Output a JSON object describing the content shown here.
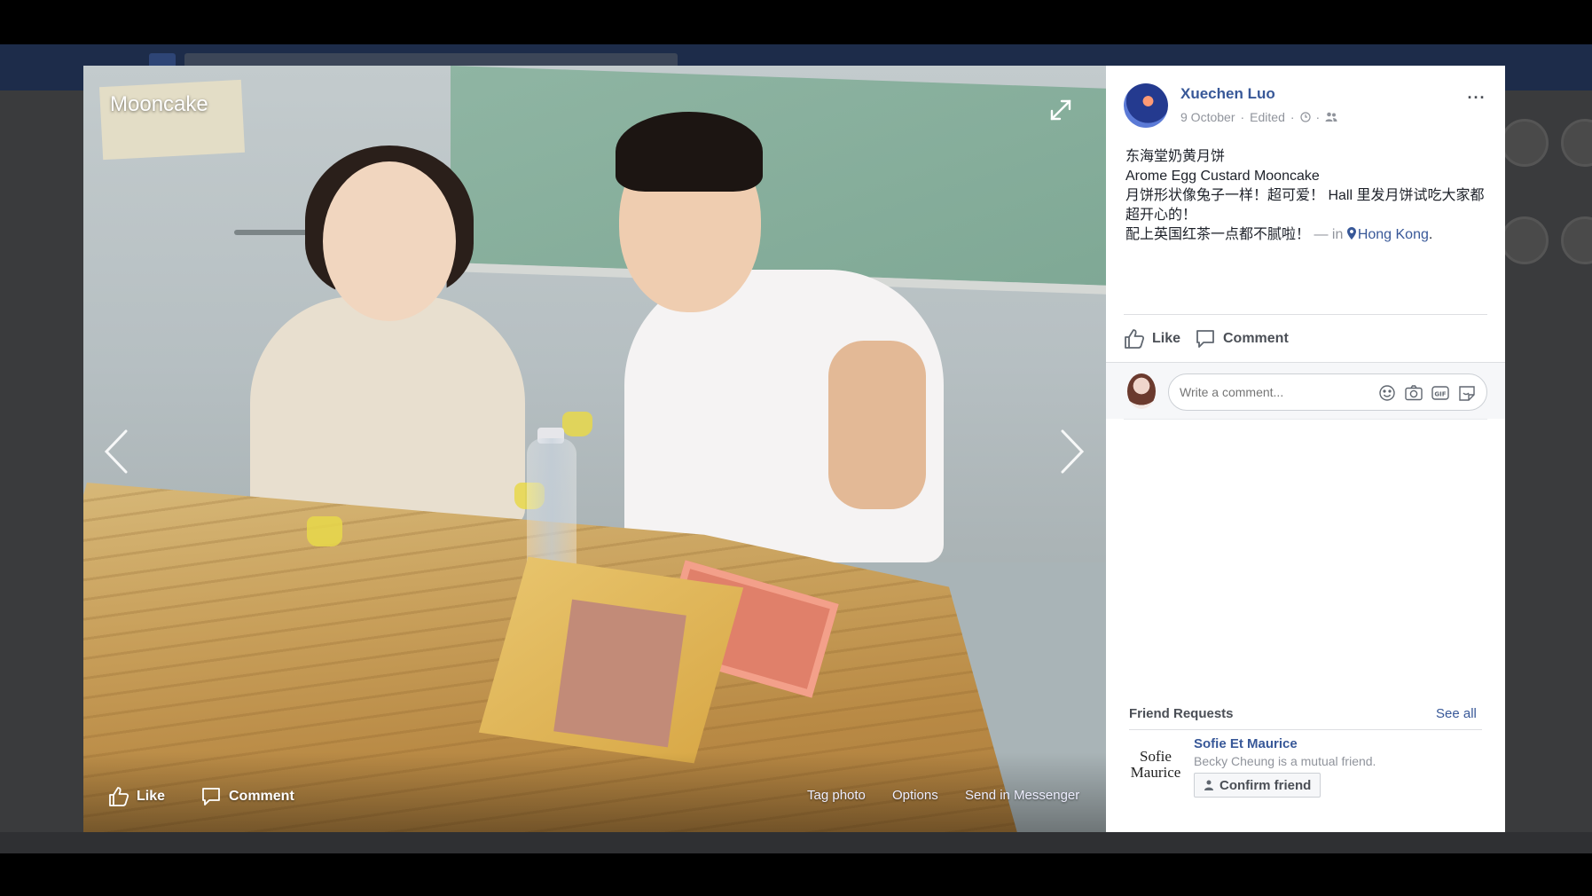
{
  "photo": {
    "title": "Mooncake",
    "footer": {
      "like_label": "Like",
      "comment_label": "Comment",
      "tag_photo_label": "Tag photo",
      "options_label": "Options",
      "send_label": "Send in Messenger"
    },
    "icons": {
      "expand": "expand-icon",
      "prev": "chevron-left-icon",
      "next": "chevron-right-icon"
    }
  },
  "post": {
    "author": "Xuechen Luo",
    "date": "9 October",
    "edited": "Edited",
    "separator": "·",
    "text_lines": [
      "东海堂奶黄月饼",
      "Arome Egg Custard Mooncake",
      "月饼形状像兔子一样！超可爱！ Hall 里发月饼试吃大家都超开心的！",
      "配上英国红茶一点都不腻啦！"
    ],
    "location_prefix": " — in ",
    "location": "Hong Kong",
    "location_suffix": ".",
    "more_label": "···"
  },
  "actions": {
    "like_label": "Like",
    "comment_label": "Comment"
  },
  "comment_box": {
    "placeholder": "Write a comment..."
  },
  "friend_requests": {
    "header": "Friend Requests",
    "see_all": "See all",
    "items": [
      {
        "logo_text": "Sofie\nMaurice",
        "name": "Sofie Et Maurice",
        "mutual": "Becky Cheung is a mutual friend.",
        "confirm_label": "Confirm friend"
      }
    ]
  },
  "colors": {
    "link": "#385898",
    "meta": "#90949c",
    "text": "#1d2129",
    "panel_bg": "#ffffff",
    "backdrop": "#000000"
  }
}
